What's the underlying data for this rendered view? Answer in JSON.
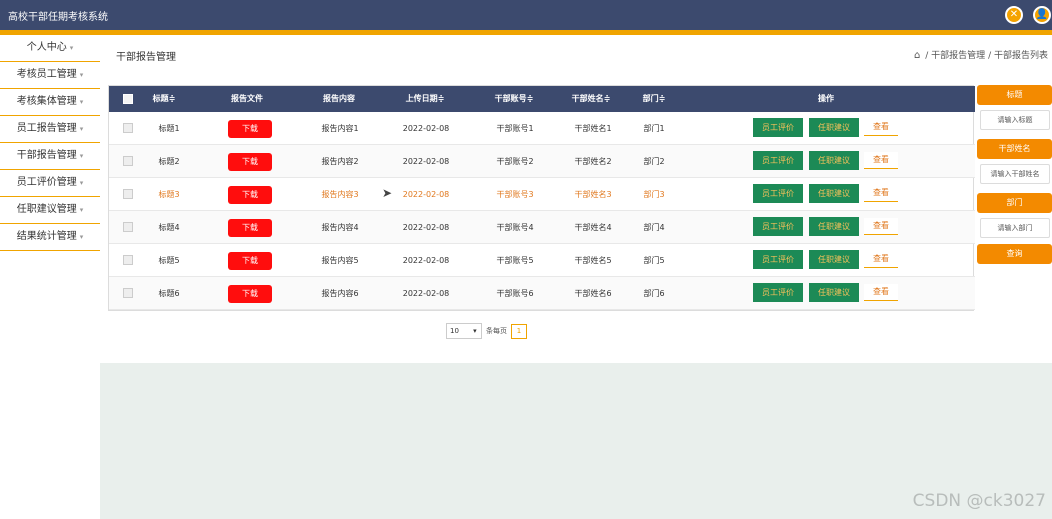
{
  "app": {
    "title": "高校干部任期考核系统"
  },
  "header": {
    "icon_left": "✕",
    "icon_right": "👤"
  },
  "sidebar": {
    "items": [
      {
        "label": "个人中心"
      },
      {
        "label": "考核员工管理"
      },
      {
        "label": "考核集体管理"
      },
      {
        "label": "员工报告管理"
      },
      {
        "label": "干部报告管理"
      },
      {
        "label": "员工评价管理"
      },
      {
        "label": "任职建议管理"
      },
      {
        "label": "结果统计管理"
      }
    ],
    "caret": "▾"
  },
  "page": {
    "title": "干部报告管理",
    "breadcrumb": {
      "home_icon": "⌂",
      "level1": "干部报告管理",
      "level2": "干部报告列表",
      "sep": "/"
    }
  },
  "table": {
    "headers": [
      "标题≑",
      "报告文件",
      "报告内容",
      "上传日期≑",
      "干部账号≑",
      "干部姓名≑",
      "部门≑",
      "操作"
    ],
    "rows": [
      {
        "title": "标题1",
        "download": "下载",
        "content": "报告内容1",
        "date": "2022-02-08",
        "account": "干部账号1",
        "name": "干部姓名1",
        "dept": "部门1",
        "eval": "员工评价",
        "suggest": "任职建议",
        "view": "查看"
      },
      {
        "title": "标题2",
        "download": "下载",
        "content": "报告内容2",
        "date": "2022-02-08",
        "account": "干部账号2",
        "name": "干部姓名2",
        "dept": "部门2",
        "eval": "员工评价",
        "suggest": "任职建议",
        "view": "查看"
      },
      {
        "title": "标题3",
        "download": "下载",
        "content": "报告内容3",
        "date": "2022-02-08",
        "account": "干部账号3",
        "name": "干部姓名3",
        "dept": "部门3",
        "eval": "员工评价",
        "suggest": "任职建议",
        "view": "查看"
      },
      {
        "title": "标题4",
        "download": "下载",
        "content": "报告内容4",
        "date": "2022-02-08",
        "account": "干部账号4",
        "name": "干部姓名4",
        "dept": "部门4",
        "eval": "员工评价",
        "suggest": "任职建议",
        "view": "查看"
      },
      {
        "title": "标题5",
        "download": "下载",
        "content": "报告内容5",
        "date": "2022-02-08",
        "account": "干部账号5",
        "name": "干部姓名5",
        "dept": "部门5",
        "eval": "员工评价",
        "suggest": "任职建议",
        "view": "查看"
      },
      {
        "title": "标题6",
        "download": "下载",
        "content": "报告内容6",
        "date": "2022-02-08",
        "account": "干部账号6",
        "name": "干部姓名6",
        "dept": "部门6",
        "eval": "员工评价",
        "suggest": "任职建议",
        "view": "查看"
      }
    ]
  },
  "pagination": {
    "page_size": "10",
    "label": "条每页",
    "current_page": "1"
  },
  "search": {
    "title_label": "标题",
    "title_placeholder": "请输入标题",
    "name_label": "干部姓名",
    "name_placeholder": "请输入干部姓名",
    "dept_label": "部门",
    "dept_placeholder": "请输入部门",
    "query_button": "查询"
  },
  "watermark": "CSDN @ck3027",
  "colors": {
    "header": "#3c4a6e",
    "accent": "#f0a400",
    "danger": "#ff0d0d",
    "green": "#1c8a56",
    "orange": "#f38a00"
  }
}
